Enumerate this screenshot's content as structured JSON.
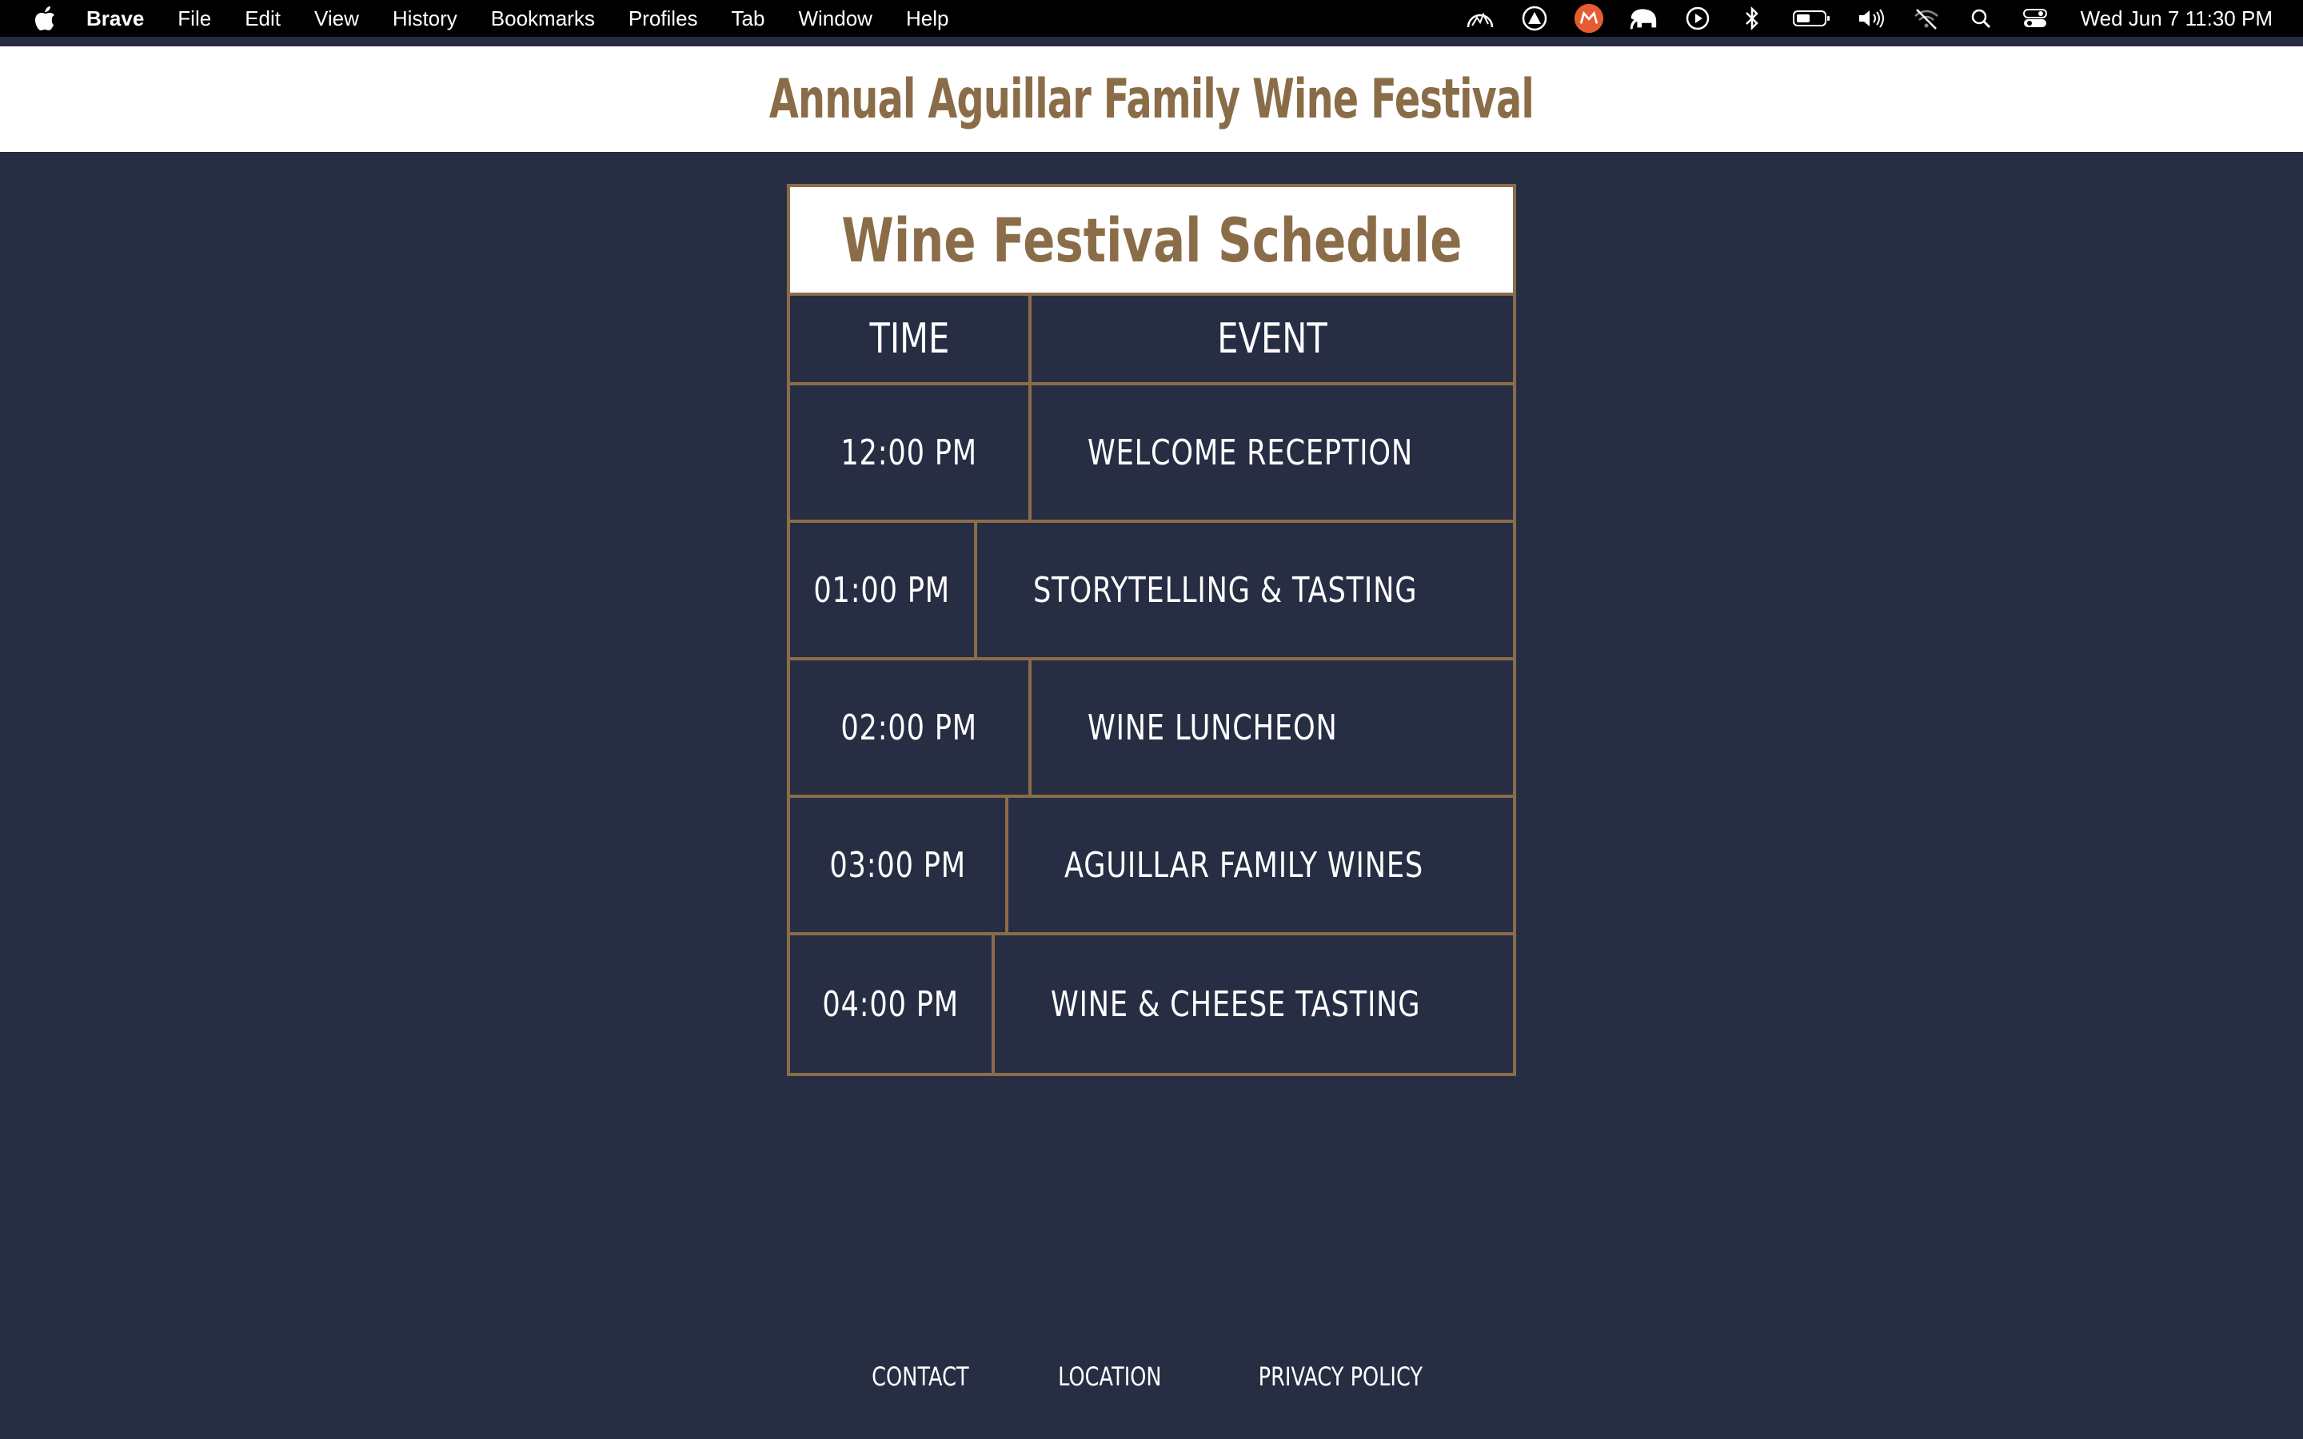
{
  "menubar": {
    "app_name": "Brave",
    "items": [
      "File",
      "Edit",
      "View",
      "History",
      "Bookmarks",
      "Profiles",
      "Tab",
      "Window",
      "Help"
    ],
    "clock": "Wed Jun 7  11:30 PM",
    "status_icons": [
      "activity-monitor-icon",
      "vpn-icon",
      "brave-rewards-icon",
      "elephant-icon",
      "play-icon",
      "bluetooth-icon",
      "battery-icon",
      "volume-icon",
      "wifi-off-icon",
      "spotlight-search-icon",
      "control-center-icon"
    ]
  },
  "header": {
    "title": "Annual Aguillar Family Wine Festival"
  },
  "schedule": {
    "title": "Wine Festival Schedule",
    "columns": [
      "TIME",
      "EVENT"
    ],
    "rows": [
      {
        "time": "12:00 PM",
        "event": "WELCOME RECEPTION"
      },
      {
        "time": "01:00 PM",
        "event": "STORYTELLING & TASTING"
      },
      {
        "time": "02:00 PM",
        "event": "WINE LUNCHEON"
      },
      {
        "time": "03:00 PM",
        "event": "AGUILLAR FAMILY WINES"
      },
      {
        "time": "04:00 PM",
        "event": "WINE & CHEESE TASTING"
      }
    ]
  },
  "footer": {
    "links": [
      "CONTACT",
      "LOCATION",
      "PRIVACY POLICY"
    ]
  },
  "colors": {
    "background": "#272d43",
    "accent": "#8a6d48",
    "header_bg": "#ffffff"
  }
}
